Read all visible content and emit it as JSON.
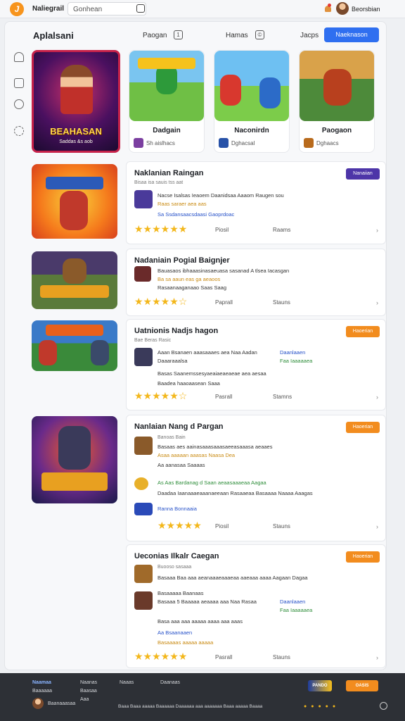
{
  "topbar": {
    "logo_letter": "J",
    "app_name": "Naliegrail",
    "search_text": "Gonhean",
    "user_name": "Beorsbian"
  },
  "page": {
    "title": "Aplalsani",
    "filters": [
      {
        "label": "Paogan",
        "icon": "1"
      },
      {
        "label": "Hamas",
        "icon": "©"
      },
      {
        "label": "Jacps",
        "icon": ""
      }
    ],
    "primary_button": "Naeknason"
  },
  "featured": {
    "main": {
      "title": "BEAHASAN",
      "sub": "Saddas &s aob"
    },
    "cards": [
      {
        "title": "Dadgain",
        "meta": "Sh aislhacs"
      },
      {
        "title": "Naconirdn",
        "meta": "Dghacsal"
      },
      {
        "title": "Paogaon",
        "meta": "Dghaacs"
      }
    ]
  },
  "rows": [
    {
      "title": "Naklanian Raingan",
      "badge": "Nanaiian",
      "sub": "Bisaa isa sauis tss aat",
      "lines": [
        "Nacse Isalsas Ieaoem Daanidsaa Aaaom Raugen sou",
        "Raas saraer aea aas",
        "Sa Ssdansaacsdaasi Gaoprdoac"
      ],
      "action1": "Piosil",
      "action2": "Raams",
      "rating": "★★★★★★"
    },
    {
      "title": "Nadaniain Pogial Baignjer",
      "sub": "",
      "lines": [
        "Bauasaos ibhaaasinasaeuasa sasanad A tlsea Iacasgan",
        "Ba sa aaun eas ga aeaoos",
        "Rasaanaaganaao Saas Saag"
      ],
      "action1": "Paprall",
      "action2": "Stauns",
      "rating": "★★★★★☆"
    },
    {
      "title": "Uatnionis Nadjs hagon",
      "badge": "Haoerian",
      "sub": "Bae Beras Rasic",
      "lines": [
        "Aaan Bsanaen aaasaaaes aea Naa Aadan",
        "Daaaraaalsa",
        "Basas Saanemssesyaeaiaeaeaeae aea aesaa",
        "Baadea haaoaasean Saaa"
      ],
      "blue": "Daanlaaen",
      "green": "Faa Iaaaaaea",
      "action1": "Pasrall",
      "action2": "Stamns",
      "rating": "★★★★★☆"
    },
    {
      "title": "Nanlaian Nang d Pargan",
      "badge": "Haoerian",
      "sub": "Banoas Bain",
      "lines": [
        "Basaas aes aainasaaasaaasaeeasaaasa aeaaes",
        "Aa aanasaa Saaaas",
        "Asaa aaaaan aaasas Naasa Dea",
        "Daadaa Iaanaaaeaaanaeeaan Rasaaeaa Basaaaa Naaaa Aaagas"
      ],
      "green": "As Aas Bardanag d Saan aeaasaaaeaa Aagaa",
      "blue": "Ranna Bonnaaia",
      "action1": "Piosil",
      "action2": "Stauns",
      "rating": "★★★★★"
    },
    {
      "title": "Ueconias Ilkalr Caegan",
      "badge": "Haoerian",
      "sub": "Buooso sasaaa",
      "lines": [
        "Basaaa Baa aaa aeanaaaeaaaeaa aaeaaa aaaa Aagaan Dagaa",
        "Basaaaaa Baanaas",
        "Basaaa 5 Baaaaa aeaaaa aaa Naa Rasaa",
        "Basa aaa aaa aaaaa aaaa aaa aaas",
        "Aa Bsaanaaen",
        "Basaaaas aaaaa aaaaa"
      ],
      "blue": "Daanlaaen",
      "green": "Faa Iaaaaaea",
      "action1": "Pasrall",
      "action2": "Stauns",
      "rating": "★★★★★★"
    }
  ],
  "footer": {
    "cols": [
      "Naamaa",
      "Naanas",
      "Naaas",
      "Daanaas"
    ],
    "col2": [
      "Baasaa",
      "Aaa"
    ],
    "sub1": "Baaaaaa",
    "user": "Baanaaasaa",
    "logo1": "PANDO",
    "logo2": "OASIS",
    "bottom": "Baaa Baaa aaaaa Baaaaaa Daaaaaa aaa aaaaaaa Baaa aaaaa Baaaa"
  }
}
